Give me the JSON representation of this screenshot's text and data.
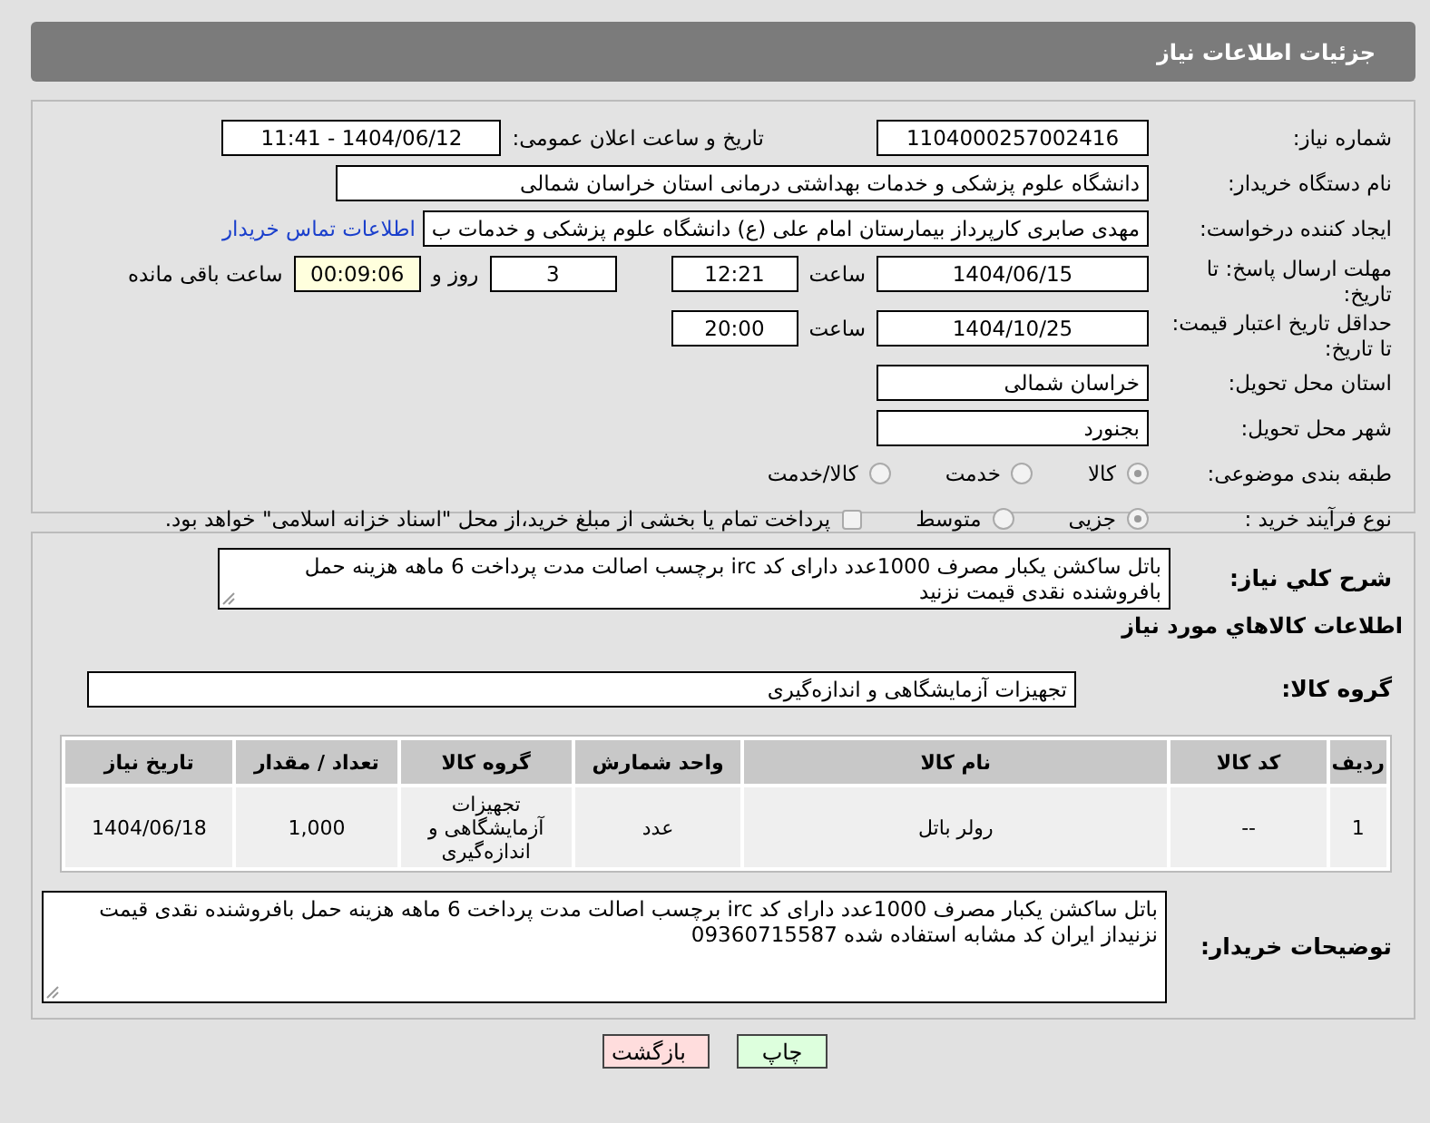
{
  "title": "جزئیات اطلاعات نیاز",
  "need_number": {
    "label": "شماره نیاز:",
    "value": "1104000257002416"
  },
  "announce": {
    "label": "تاریخ و ساعت اعلان عمومی:",
    "value": "1404/06/12 - 11:41"
  },
  "buyer_org": {
    "label": "نام دستگاه خریدار:",
    "value": "دانشگاه علوم پزشکی و خدمات بهداشتی درمانی استان خراسان شمالی"
  },
  "requester": {
    "label": "ایجاد کننده درخواست:",
    "value": "مهدی صابری کارپرداز بیمارستان امام علی (ع) دانشگاه علوم پزشکی و خدمات ب",
    "link": "اطلاعات تماس خریدار"
  },
  "reply_deadline": {
    "label": "مهلت ارسال پاسخ: تا تاریخ:",
    "date": "1404/06/15",
    "time_label": "ساعت",
    "time": "12:21",
    "days": "3",
    "days_label": "روز و",
    "remaining": "00:09:06",
    "remaining_label": "ساعت باقی مانده"
  },
  "price_validity": {
    "label": "حداقل تاریخ اعتبار قیمت: تا تاریخ:",
    "date": "1404/10/25",
    "time_label": "ساعت",
    "time": "20:00"
  },
  "province": {
    "label": "استان محل تحویل:",
    "value": "خراسان شمالی"
  },
  "city": {
    "label": "شهر محل تحویل:",
    "value": "بجنورد"
  },
  "category": {
    "label": "طبقه بندی موضوعی:",
    "options": [
      {
        "label": "کالا",
        "selected": true
      },
      {
        "label": "خدمت",
        "selected": false
      },
      {
        "label": "کالا/خدمت",
        "selected": false
      }
    ]
  },
  "purchase_type": {
    "label": "نوع فرآیند خرید :",
    "options": [
      {
        "label": "جزیی",
        "selected": true
      },
      {
        "label": "متوسط",
        "selected": false
      }
    ],
    "checkbox": {
      "label": "پرداخت تمام یا بخشی از مبلغ خرید،از محل \"اسناد خزانه اسلامی\" خواهد بود.",
      "checked": false
    }
  },
  "description": {
    "label": "شرح کلي نياز:",
    "value": "باتل ساکشن یکبار مصرف 1000عدد دارای کد irc برچسب اصالت مدت پرداخت 6 ماهه هزینه حمل بافروشنده نقدی قیمت نزنید"
  },
  "goods_title": "اطلاعات کالاهاي مورد نياز",
  "goods_group": {
    "label": "گروه کالا:",
    "value": "تجهیزات آزمایشگاهی و اندازه‌گیری"
  },
  "table": {
    "columns": [
      "ردیف",
      "کد کالا",
      "نام کالا",
      "واحد شمارش",
      "گروه کالا",
      "تعداد / مقدار",
      "تاریخ نیاز"
    ],
    "rows": [
      [
        "1",
        "--",
        "رولر باتل",
        "عدد",
        "تجهیزات آزمایشگاهی و اندازه‌گیری",
        "1,000",
        "1404/06/18"
      ]
    ]
  },
  "buyer_notes": {
    "label": "توضیحات خریدار:",
    "value": "باتل ساکشن یکبار مصرف 1000عدد دارای کد irc برچسب اصالت مدت پرداخت 6 ماهه هزینه حمل بافروشنده نقدی قیمت نزنیداز ایران کد مشابه استفاده شده 09360715587"
  },
  "buttons": [
    {
      "label": "چاپ",
      "kind": "print"
    },
    {
      "label": "بازگشت",
      "kind": "back"
    }
  ]
}
